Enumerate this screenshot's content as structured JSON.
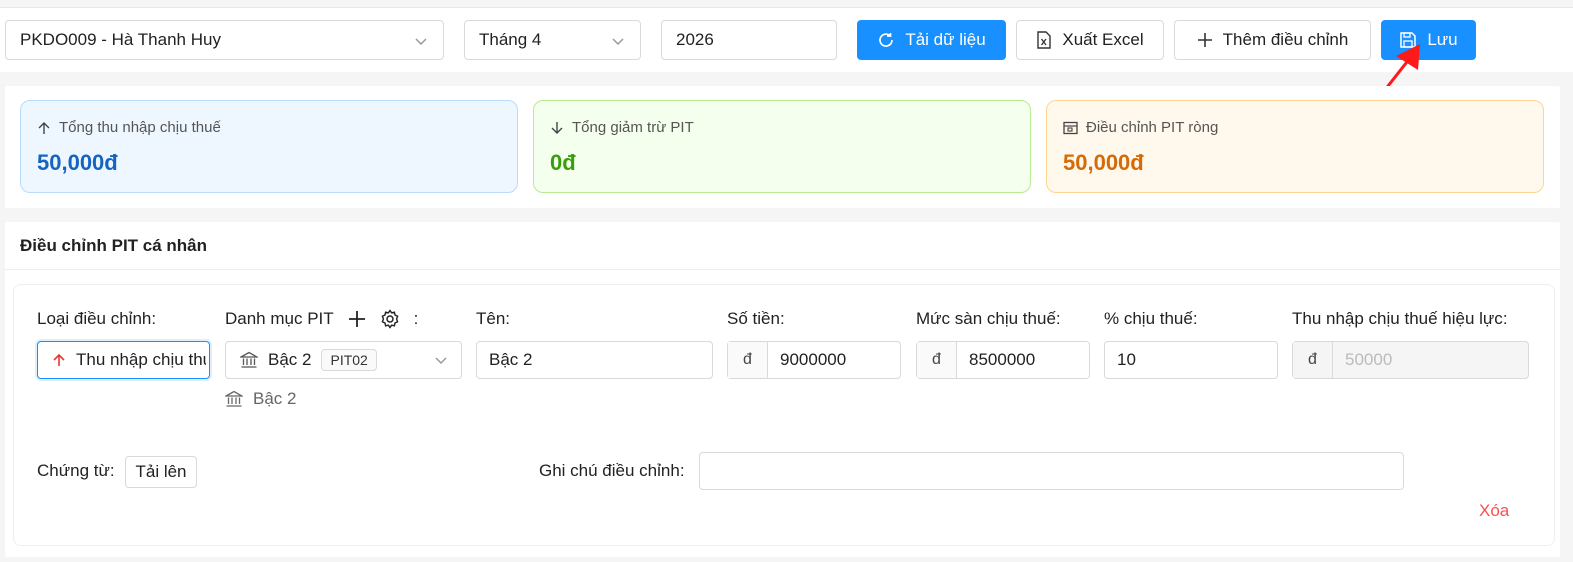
{
  "toolbar": {
    "employee_select": "PKDO009 - Hà Thanh Huy",
    "month_select": "Tháng 4",
    "year_value": "2026",
    "load_button": "Tải dữ liệu",
    "export_button": "Xuất Excel",
    "add_button": "Thêm điều chỉnh",
    "save_button": "Lưu"
  },
  "summary": {
    "taxable_income": {
      "label": "Tổng thu nhập chịu thuế",
      "value": "50,000đ",
      "icon": "arrow-up-icon"
    },
    "pit_deduction": {
      "label": "Tổng giảm trừ PIT",
      "value": "0đ",
      "icon": "arrow-down-icon"
    },
    "net_adjustment": {
      "label": "Điều chỉnh PIT ròng",
      "value": "50,000đ",
      "icon": "wallet-icon"
    }
  },
  "section": {
    "title": "Điều chỉnh PIT cá nhân",
    "labels": {
      "adjust_type": "Loại điều chỉnh",
      "pit_category": "Danh mục PIT",
      "name": "Tên",
      "amount": "Số tiền",
      "floor": "Mức sàn chịu thuế",
      "percent": "% chịu thuế",
      "effective_income": "Thu nhập chịu thuế hiệu lực",
      "voucher": "Chứng từ:",
      "note": "Ghi chú điều chỉnh"
    },
    "row": {
      "adjust_type_value": "Thu nhập chịu thuế",
      "pit_category_value": "Bậc 2",
      "pit_category_tag": "PIT02",
      "pit_category_hint": "Bậc 2",
      "name_value": "Bậc 2",
      "currency": "đ",
      "amount_value": "9000000",
      "floor_value": "8500000",
      "percent_value": "10",
      "effective_income_value": "50000",
      "upload_button": "Tải lên",
      "delete_link": "Xóa"
    }
  },
  "colors": {
    "primary": "#1890ff",
    "annotation_arrow": "#ff1a1a",
    "danger": "#ff4d4f"
  }
}
